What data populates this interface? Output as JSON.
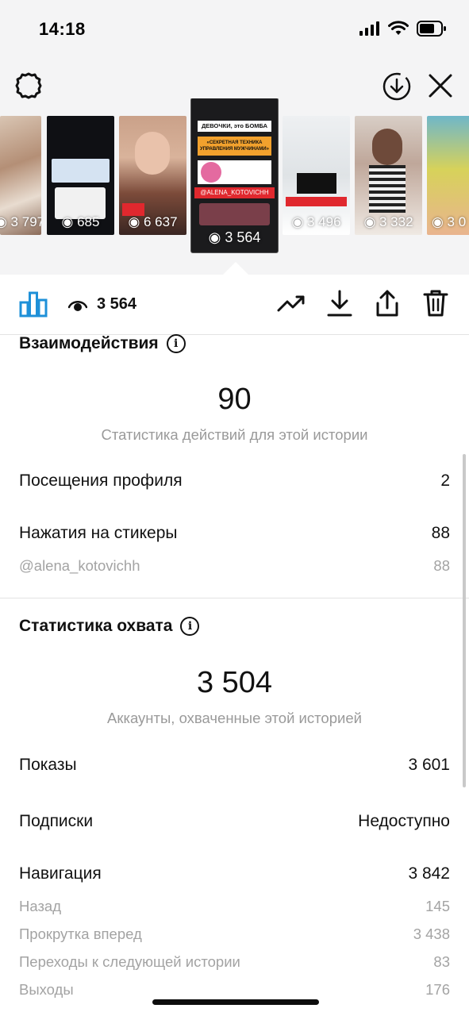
{
  "status_bar": {
    "time": "14:18"
  },
  "story_strip": {
    "thumbnails": [
      {
        "views": "3 797"
      },
      {
        "views": "685"
      },
      {
        "views": "6 637"
      },
      {
        "views": "3 564",
        "selected": true
      },
      {
        "views": "3 496"
      },
      {
        "views": "3 332"
      },
      {
        "views": "3 0"
      }
    ],
    "selected_text": {
      "title": "ДЕВОЧКИ, это БОМБА",
      "banner": "«СЕКРЕТНАЯ ТЕХНИКА УПРАВЛЕНИЯ МУЖЧИНАМИ»",
      "handle": "@ALENA_KOTOVICHH"
    }
  },
  "action_bar": {
    "views": "3 564"
  },
  "interactions": {
    "title": "Взаимодействия",
    "total": "90",
    "caption": "Статистика действий для этой истории",
    "rows": [
      {
        "label": "Посещения профиля",
        "value": "2"
      },
      {
        "label": "Нажатия на стикеры",
        "value": "88"
      }
    ],
    "sub_rows": [
      {
        "label": "@alena_kotovichh",
        "value": "88"
      }
    ]
  },
  "reach": {
    "title": "Статистика охвата",
    "total": "3 504",
    "caption": "Аккаунты, охваченные этой историей",
    "rows": [
      {
        "label": "Показы",
        "value": "3 601"
      },
      {
        "label": "Подписки",
        "value": "Недоступно"
      },
      {
        "label": "Навигация",
        "value": "3 842"
      }
    ],
    "sub_rows": [
      {
        "label": "Назад",
        "value": "145"
      },
      {
        "label": "Прокрутка вперед",
        "value": "3 438"
      },
      {
        "label": "Переходы к следующей истории",
        "value": "83"
      },
      {
        "label": "Выходы",
        "value": "176"
      }
    ]
  },
  "colors": {
    "accent_blue": "#1e90d8",
    "bg_top": "#f4f4f5",
    "sticker_red": "#e0282e"
  }
}
